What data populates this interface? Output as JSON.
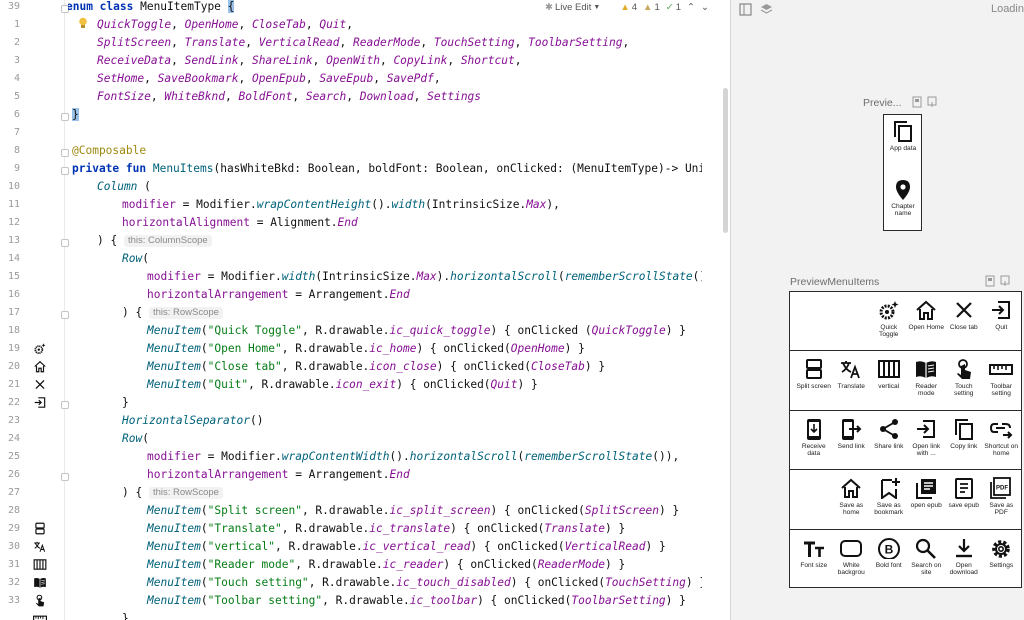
{
  "top_bar": {
    "live_edit_label": "Live Edit",
    "warnings": "4",
    "weak_warnings": "1",
    "checks": "1"
  },
  "line_numbers": [
    "39",
    "1",
    "2",
    "3",
    "4",
    "5",
    "6",
    "7",
    "8",
    "9",
    "10",
    "11",
    "12",
    "13",
    "14",
    "15",
    "16",
    "17",
    "18",
    "19",
    "20",
    "21",
    "22",
    "23",
    "24",
    "25",
    "26",
    "27",
    "28",
    "29",
    "30",
    "31",
    "32",
    "33"
  ],
  "code": {
    "enum_decl": "enum class MenuItemType {",
    "enum_line1": "QuickToggle, OpenHome, CloseTab, Quit,",
    "enum_line2": "SplitScreen, Translate, VerticalRead, ReaderMode, TouchSetting, ToolbarSetting,",
    "enum_line3": "ReceiveData, SendLink, ShareLink, OpenWith, CopyLink, Shortcut,",
    "enum_line4": "SetHome, SaveBookmark, OpenEpub, SaveEpub, SavePdf,",
    "enum_line5": "FontSize, WhiteBknd, BoldFont, Search, Download, Settings",
    "enum_close": "}",
    "annotation": "@Composable",
    "fun_sig": "private fun MenuItems(hasWhiteBkd: Boolean, boldFont: Boolean, onClicked: (MenuItemType)-> Unit) {",
    "column_open": "Column (",
    "modifier1": "modifier = Modifier.wrapContentHeight().width(IntrinsicSize.Max),",
    "halign": "horizontalAlignment = Alignment.End",
    "close_paren_brace": ") {",
    "hint_column_scope": "this: ColumnScope",
    "row_open": "Row(",
    "modifier2": "modifier = Modifier.width(IntrinsicSize.Max).horizontalScroll(rememberScrollState()),",
    "harr1": "horizontalArrangement = Arrangement.End",
    "hint_row_scope": "this: RowScope",
    "mi1": "MenuItem(\"Quick Toggle\", R.drawable.ic_quick_toggle) { onClicked (QuickToggle) }",
    "mi2": "MenuItem(\"Open Home\", R.drawable.ic_home) { onClicked(OpenHome) }",
    "mi3": "MenuItem(\"Close tab\", R.drawable.icon_close) { onClicked(CloseTab) }",
    "mi4": "MenuItem(\"Quit\", R.drawable.icon_exit) { onClicked(Quit) }",
    "close_brace": "}",
    "hsep": "HorizontalSeparator()",
    "modifier3": "modifier = Modifier.wrapContentWidth().horizontalScroll(rememberScrollState()),",
    "harr2": "horizontalArrangement = Arrangement.End",
    "mi5": "MenuItem(\"Split screen\", R.drawable.ic_split_screen) { onClicked(SplitScreen) }",
    "mi6": "MenuItem(\"Translate\", R.drawable.ic_translate) { onClicked(Translate) }",
    "mi7": "MenuItem(\"vertical\", R.drawable.ic_vertical_read) { onClicked(VerticalRead) }",
    "mi8": "MenuItem(\"Reader mode\", R.drawable.ic_reader) { onClicked(ReaderMode) }",
    "mi9": "MenuItem(\"Touch setting\", R.drawable.ic_touch_disabled) { onClicked(TouchSetting) }",
    "mi10": "MenuItem(\"Toolbar setting\", R.drawable.ic_toolbar) { onClicked(ToolbarSetting) }",
    "last_brace": "}"
  },
  "preview": {
    "loading_label": "Loadin",
    "preview1_title": "Previe...",
    "preview1_items": [
      {
        "label": "App data",
        "icon": "copy-icon"
      },
      {
        "label": "Chapter name",
        "icon": "location-pin-icon"
      }
    ],
    "preview2_title": "PreviewMenuItems",
    "rows": [
      [
        {
          "label": "Quick Toggle",
          "icon": "gear-sparkle-icon"
        },
        {
          "label": "Open Home",
          "icon": "home-icon"
        },
        {
          "label": "Close tab",
          "icon": "close-icon"
        },
        {
          "label": "Quit",
          "icon": "exit-icon"
        }
      ],
      [
        {
          "label": "Split screen",
          "icon": "split-screen-icon"
        },
        {
          "label": "Translate",
          "icon": "translate-icon"
        },
        {
          "label": "vertical",
          "icon": "vertical-read-icon"
        },
        {
          "label": "Reader mode",
          "icon": "book-icon"
        },
        {
          "label": "Touch setting",
          "icon": "touch-icon"
        },
        {
          "label": "Toolbar setting",
          "icon": "ruler-icon"
        }
      ],
      [
        {
          "label": "Receive data",
          "icon": "download-phone-icon"
        },
        {
          "label": "Send link",
          "icon": "send-link-icon"
        },
        {
          "label": "Share link",
          "icon": "share-icon"
        },
        {
          "label": "Open link with ...",
          "icon": "open-with-icon"
        },
        {
          "label": "Copy link",
          "icon": "copy-icon"
        },
        {
          "label": "Shortcut on home",
          "icon": "shortcut-icon"
        }
      ],
      [
        {
          "label": "Save as home",
          "icon": "home-icon"
        },
        {
          "label": "Save as bookmark",
          "icon": "bookmark-add-icon"
        },
        {
          "label": "open epub",
          "icon": "library-icon"
        },
        {
          "label": "save epub",
          "icon": "document-icon"
        },
        {
          "label": "Save as PDF",
          "icon": "pdf-icon"
        }
      ],
      [
        {
          "label": "Font size",
          "icon": "font-size-icon"
        },
        {
          "label": "White backgrou",
          "icon": "rounded-rect-icon"
        },
        {
          "label": "Bold font",
          "icon": "bold-circle-icon"
        },
        {
          "label": "Search on site",
          "icon": "search-icon"
        },
        {
          "label": "Open download",
          "icon": "download-icon"
        },
        {
          "label": "Settings",
          "icon": "gear-icon"
        }
      ]
    ]
  }
}
